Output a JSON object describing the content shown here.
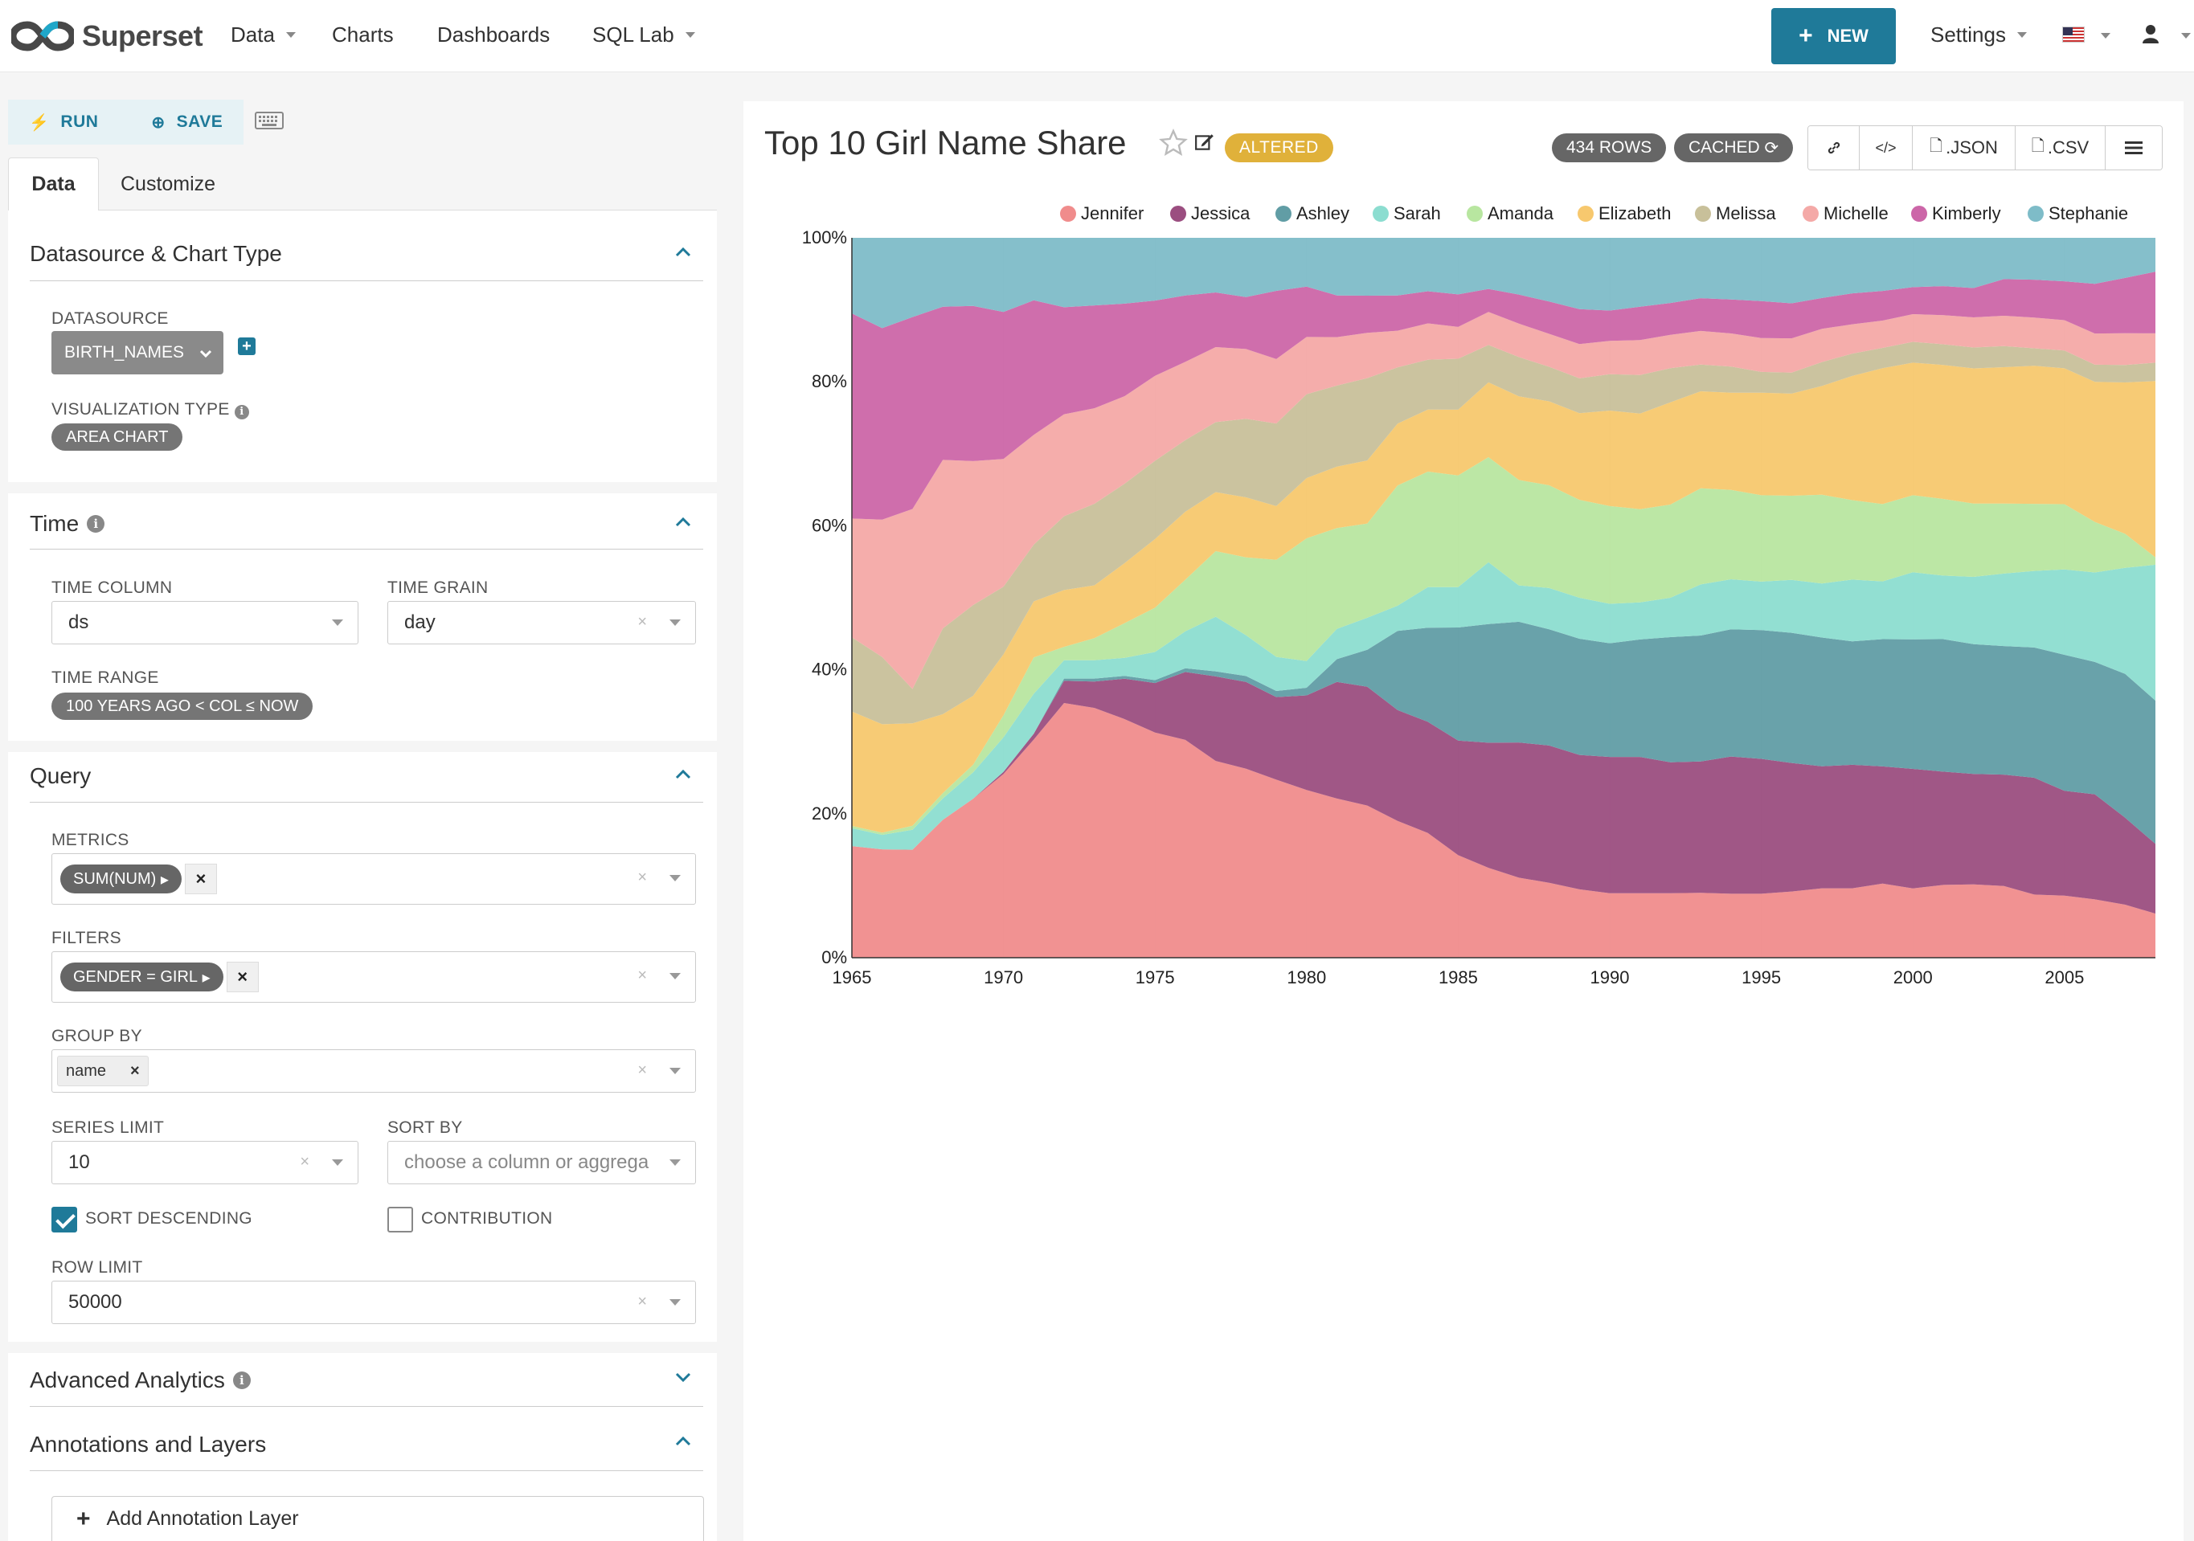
{
  "navbar": {
    "brand": "Superset",
    "items": [
      {
        "label": "Data",
        "dropdown": true
      },
      {
        "label": "Charts",
        "dropdown": false
      },
      {
        "label": "Dashboards",
        "dropdown": false
      },
      {
        "label": "SQL Lab",
        "dropdown": true
      }
    ],
    "new_label": "NEW",
    "settings_label": "Settings"
  },
  "toolbar": {
    "run_label": "RUN",
    "save_label": "SAVE"
  },
  "tabs": {
    "data": "Data",
    "customize": "Customize"
  },
  "sections": {
    "datasource": {
      "title": "Datasource & Chart Type",
      "datasource_label": "DATASOURCE",
      "datasource_value": "BIRTH_NAMES",
      "viz_label": "VISUALIZATION TYPE",
      "viz_value": "AREA CHART"
    },
    "time": {
      "title": "Time",
      "time_column_label": "TIME COLUMN",
      "time_column_value": "ds",
      "time_grain_label": "TIME GRAIN",
      "time_grain_value": "day",
      "time_range_label": "TIME RANGE",
      "time_range_value": "100 YEARS AGO < COL ≤ NOW"
    },
    "query": {
      "title": "Query",
      "metrics_label": "METRICS",
      "metrics_value": "SUM(NUM)",
      "filters_label": "FILTERS",
      "filters_value": "GENDER = GIRL",
      "groupby_label": "GROUP BY",
      "groupby_value": "name",
      "series_limit_label": "SERIES LIMIT",
      "series_limit_value": "10",
      "sort_by_label": "SORT BY",
      "sort_by_placeholder": "choose a column or aggrega",
      "sort_desc_label": "SORT DESCENDING",
      "sort_desc_checked": true,
      "contribution_label": "CONTRIBUTION",
      "contribution_checked": false,
      "row_limit_label": "ROW LIMIT",
      "row_limit_value": "50000"
    },
    "advanced": {
      "title": "Advanced Analytics"
    },
    "annotations": {
      "title": "Annotations and Layers",
      "add_label": "Add Annotation Layer"
    }
  },
  "chart_header": {
    "title": "Top 10 Girl Name Share",
    "altered": "ALTERED",
    "rows": "434 ROWS",
    "cached": "CACHED",
    "json_label": ".JSON",
    "csv_label": ".CSV"
  },
  "chart_data": {
    "type": "area",
    "stacked": "expand",
    "title": "",
    "xlabel": "",
    "ylabel": "",
    "x": [
      1965,
      1966,
      1967,
      1968,
      1969,
      1970,
      1971,
      1972,
      1973,
      1974,
      1975,
      1976,
      1977,
      1978,
      1979,
      1980,
      1981,
      1982,
      1983,
      1984,
      1985,
      1986,
      1987,
      1988,
      1989,
      1990,
      1991,
      1992,
      1993,
      1994,
      1995,
      1996,
      1997,
      1998,
      1999,
      2000,
      2001,
      2002,
      2003,
      2004,
      2005,
      2006,
      2007,
      2008
    ],
    "xticks": [
      1965,
      1970,
      1975,
      1980,
      1985,
      1990,
      1995,
      2000,
      2005
    ],
    "yticks": [
      "0%",
      "20%",
      "40%",
      "60%",
      "80%",
      "100%"
    ],
    "ylim": [
      0,
      100
    ],
    "legend_position": "top",
    "series": [
      {
        "name": "Jennifer",
        "color": "#f08c8c",
        "values": [
          15.5,
          15,
          13.5,
          18,
          21,
          25,
          30,
          34.5,
          34,
          33,
          30.5,
          29.5,
          27,
          25.5,
          23.5,
          22,
          21,
          20.5,
          19,
          17.5,
          14.5,
          12.5,
          11,
          10,
          9,
          8.5,
          8.5,
          8.5,
          8.5,
          8.3,
          8.3,
          8.5,
          9,
          9,
          9.5,
          9,
          9.5,
          9.5,
          9.2,
          8,
          8,
          7.5,
          7,
          6
        ]
      },
      {
        "name": "Jessica",
        "color": "#9b4e80",
        "values": [
          0,
          0,
          0,
          0,
          0,
          0.3,
          0.8,
          3,
          3.6,
          5.6,
          6.7,
          9.2,
          11.6,
          11.7,
          10.9,
          12.4,
          15.4,
          16,
          15.4,
          15.6,
          16.2,
          17.4,
          18.6,
          18.3,
          17.7,
          18,
          18,
          17.3,
          17.2,
          17.8,
          17.5,
          16.5,
          15.8,
          16,
          15,
          15.5,
          14.8,
          14.3,
          14.3,
          14.8,
          13.5,
          13.5,
          11.5,
          9.5
        ]
      },
      {
        "name": "Ashley",
        "color": "#619da5",
        "values": [
          0,
          0,
          0,
          0,
          0,
          0,
          0,
          0.3,
          0.4,
          0.4,
          0.4,
          0.5,
          0.7,
          0.8,
          0.8,
          1,
          3,
          5,
          11,
          13.2,
          16,
          16.5,
          16.6,
          15.5,
          15.3,
          15,
          15.5,
          16.5,
          16.5,
          16.5,
          16.7,
          16.7,
          16.7,
          16,
          16.3,
          16.8,
          17.3,
          16.8,
          16.5,
          16.5,
          17.5,
          17,
          19,
          19.5
        ]
      },
      {
        "name": "Sarah",
        "color": "#8cddd0",
        "values": [
          2.5,
          2,
          2.5,
          2.8,
          3.5,
          4.7,
          5.5,
          2.5,
          2.5,
          2.5,
          3.8,
          5,
          7.5,
          5.5,
          4.5,
          3.5,
          4,
          4.3,
          3.5,
          5.7,
          5.7,
          8.6,
          5,
          5.5,
          5.4,
          5.2,
          4.9,
          5.2,
          6.7,
          6.5,
          6.3,
          6.8,
          7,
          8,
          7.4,
          8.7,
          8.3,
          8.7,
          9.3,
          9.7,
          11,
          11.5,
          14,
          18.5
        ]
      },
      {
        "name": "Amanda",
        "color": "#b8e6a0",
        "values": [
          0.3,
          0.3,
          0.5,
          0.7,
          1,
          3,
          5,
          1.8,
          3,
          4.8,
          6,
          7,
          9,
          10.5,
          12.8,
          16.1,
          13.3,
          12.7,
          16.7,
          16.2,
          15.8,
          14.6,
          14.5,
          13.7,
          12.9,
          12.9,
          12.3,
          12.3,
          12.6,
          11.6,
          11.2,
          10.8,
          11.5,
          10.3,
          9.9,
          10,
          10,
          9.5,
          9,
          8.5,
          8.4,
          6.5,
          4.5,
          1
        ]
      },
      {
        "name": "Elizabeth",
        "color": "#f7c86e",
        "values": [
          15.9,
          15,
          12.8,
          10.3,
          9.1,
          8.3,
          7.7,
          7.7,
          7.2,
          8.3,
          9.3,
          9.2,
          8.1,
          8.1,
          7.1,
          7.9,
          8.1,
          8.5,
          8.6,
          8.7,
          9.3,
          10.4,
          11.5,
          11.2,
          11.4,
          12.6,
          12.6,
          13.5,
          12.7,
          12.6,
          13.3,
          13.1,
          14.1,
          16.1,
          17.4,
          17.2,
          17.5,
          17.5,
          17.5,
          17.5,
          17.5,
          18,
          20,
          24
        ]
      },
      {
        "name": "Melissa",
        "color": "#c8c09a",
        "values": [
          10.3,
          9.3,
          4.3,
          11.2,
          12,
          9.2,
          7.8,
          10,
          11.1,
          11,
          10.6,
          9.7,
          9.6,
          10.6,
          10.9,
          11,
          10.7,
          11.1,
          7.8,
          7,
          7.2,
          5.2,
          5.4,
          4.6,
          4.6,
          4.8,
          5.1,
          4.5,
          3.5,
          3.4,
          2.7,
          2.7,
          3.1,
          2.9,
          2.6,
          2.7,
          2.7,
          2.7,
          2.7,
          2.2,
          2.3,
          2.2,
          2.3,
          2.5
        ]
      },
      {
        "name": "Michelle",
        "color": "#f4a9a7",
        "values": [
          16.5,
          19,
          22.5,
          22,
          19,
          17.4,
          15.1,
          13.8,
          13,
          12.1,
          11.5,
          10.6,
          10.3,
          9.4,
          8.5,
          7.5,
          6.4,
          6.1,
          5.1,
          5.1,
          4.5,
          4.6,
          4.6,
          4.4,
          4.5,
          4.4,
          4.6,
          4.4,
          4.4,
          4.3,
          4.4,
          4.4,
          4.3,
          3.8,
          3.5,
          3.6,
          3.8,
          3.9,
          3.9,
          3.9,
          3.9,
          4,
          4.2,
          4
        ]
      },
      {
        "name": "Kimberly",
        "color": "#cc66a8",
        "values": [
          28.5,
          26.5,
          24,
          20,
          20.5,
          20,
          18.5,
          14.5,
          14,
          12.8,
          10.2,
          9,
          7.5,
          7,
          9,
          6.6,
          5.5,
          5,
          4.9,
          4.5,
          4.6,
          3.2,
          4,
          4.3,
          4.6,
          4,
          4.4,
          4.2,
          4.3,
          4.4,
          4.8,
          4.5,
          4,
          4,
          3.8,
          3.5,
          3.8,
          3.8,
          4.7,
          4.8,
          5,
          6.4,
          7.3,
          8.4
        ]
      },
      {
        "name": "Stephanie",
        "color": "#7ebcc8",
        "values": [
          10.5,
          12.5,
          9.9,
          9,
          9,
          10.1,
          8.6,
          9.4,
          9.2,
          9.1,
          8.5,
          7.8,
          7.5,
          8,
          7,
          6.4,
          7.6,
          7.8,
          8,
          7.5,
          8,
          7.1,
          7.8,
          8.5,
          9.4,
          9.6,
          9.1,
          8.6,
          7.9,
          8,
          8.2,
          8.4,
          7.8,
          7.2,
          6.8,
          6.4,
          6.3,
          6.5,
          5.3,
          5.3,
          5.6,
          5.9,
          5.3,
          4.6
        ]
      }
    ]
  }
}
